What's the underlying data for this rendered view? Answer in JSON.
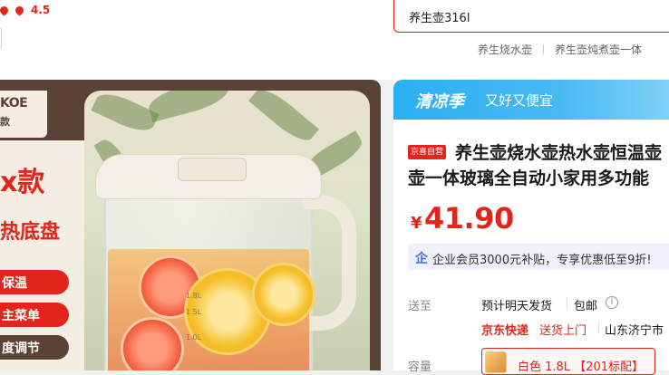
{
  "header": {
    "rating": "4.5",
    "search_value": "养生壶316l",
    "hot_words": [
      "养生烧水壶",
      "养生壶炖煮壶一体"
    ]
  },
  "image": {
    "brand": "KOE",
    "brand_sub": "款",
    "promo_big": "x款",
    "promo_mid": "热底盘",
    "chips": [
      "保温",
      "主菜单",
      "度调节"
    ],
    "scale_marks": [
      "1.8L",
      "1.5L",
      "1.0L"
    ]
  },
  "banner": {
    "title": "清凉季",
    "subtitle": "又好又便宜"
  },
  "product": {
    "self_badge": "京喜自营",
    "title_line1": "养生壶烧水壶热水壶恒温壶",
    "title_line2": "壶一体玻璃全自动小家用多功能",
    "price_symbol": "¥",
    "price": "41.90",
    "member_icon": "企",
    "member_text": "企业会员3000元补贴，专享优惠低至9折!"
  },
  "delivery": {
    "label": "送至",
    "eta": "预计明天发货",
    "postage": "包邮",
    "info_icon": "i",
    "express": "京东快递",
    "door": "送货上门",
    "region": "山东济宁市"
  },
  "capacity": {
    "label": "容量",
    "option": "白色 1.8L 【201标配】"
  },
  "colors": {
    "accent": "#e1251b",
    "banner": "#2ab0f2",
    "brand_brown": "#5b4236"
  }
}
